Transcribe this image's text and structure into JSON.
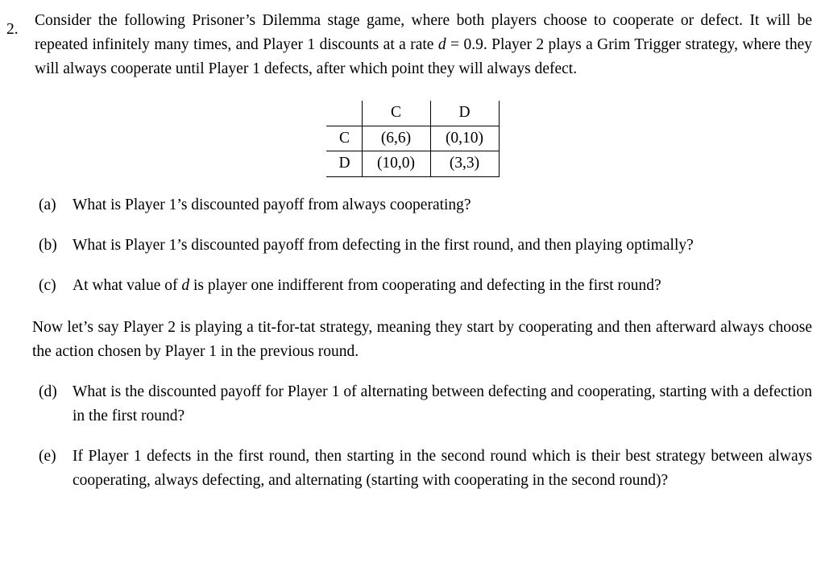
{
  "document": {
    "problem_number": "2.",
    "intro": {
      "part1": "Consider the following Prisoner’s Dilemma stage game, where both players choose to cooperate or defect. It will be repeated infinitely many times, and Player 1 discounts at a rate ",
      "math_var": "d",
      "part2": " = 0.9. Player 2 plays a Grim Trigger strategy, where they will always cooperate until Player 1 defects, after which point they will always defect."
    },
    "payoff_matrix": {
      "corner": "",
      "column_headers": [
        "C",
        "D"
      ],
      "row_headers": [
        "C",
        "D"
      ],
      "cells": [
        [
          "(6,6)",
          "(0,10)"
        ],
        [
          "(10,0)",
          "(3,3)"
        ]
      ]
    },
    "subparts": [
      {
        "label": "(a)",
        "text": "What is Player 1’s discounted payoff from always cooperating?"
      },
      {
        "label": "(b)",
        "text": "What is Player 1’s discounted payoff from defecting in the first round, and then playing optimally?"
      },
      {
        "label": "(c)",
        "text_before": "At what value of ",
        "math_var": "d",
        "text_after": " is player one indifferent from cooperating and defecting in the first round?"
      }
    ],
    "mid_paragraph": "Now let’s say Player 2 is playing a tit-for-tat strategy, meaning they start by cooperating and then afterward always choose the action chosen by Player 1 in the previous round.",
    "subparts_after": [
      {
        "label": "(d)",
        "text": "What is the discounted payoff for Player 1 of alternating between defecting and cooperating, starting with a defection in the first round?"
      },
      {
        "label": "(e)",
        "text": "If Player 1 defects in the first round, then starting in the second round which is their best strategy between always cooperating, always defecting, and alternating (starting with cooperating in the second round)?"
      }
    ]
  }
}
